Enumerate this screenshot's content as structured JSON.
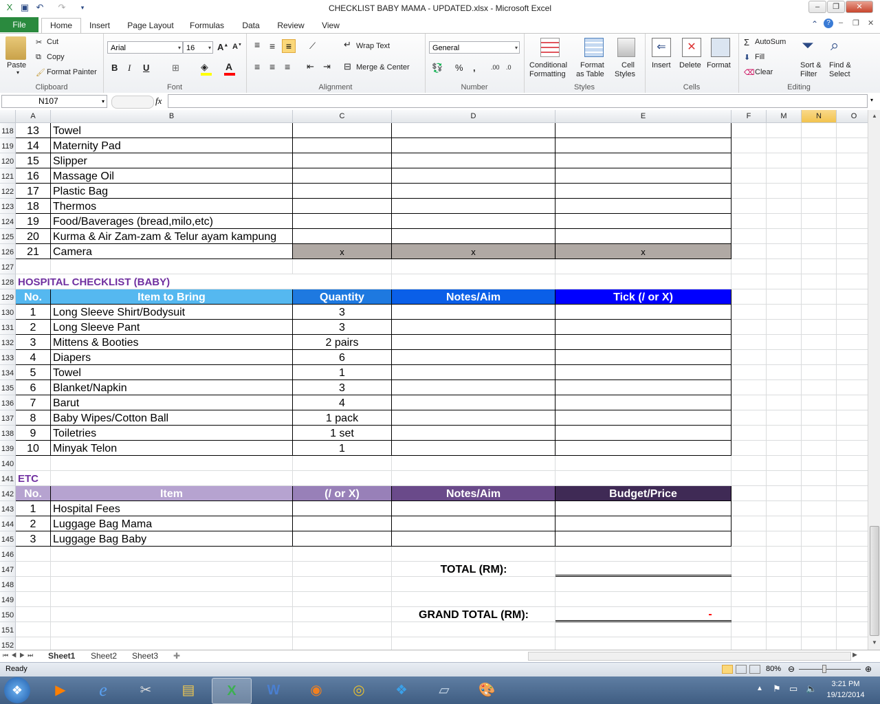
{
  "window": {
    "title": "CHECKLIST BABY MAMA - UPDATED.xlsx  -  Microsoft Excel",
    "qat_ghost_text": "..."
  },
  "tabs": [
    "File",
    "Home",
    "Insert",
    "Page Layout",
    "Formulas",
    "Data",
    "Review",
    "View"
  ],
  "ribbon": {
    "clipboard": {
      "paste": "Paste",
      "cut": "Cut",
      "copy": "Copy",
      "format_painter": "Format Painter",
      "label": "Clipboard"
    },
    "font": {
      "name": "Arial",
      "size": "16",
      "bold": "B",
      "italic": "I",
      "underline": "U",
      "label": "Font"
    },
    "alignment": {
      "wrap": "Wrap Text",
      "merge": "Merge & Center",
      "label": "Alignment"
    },
    "number": {
      "format": "General",
      "percent": "%",
      "comma": ",",
      "label": "Number"
    },
    "styles": {
      "conditional": "Conditional",
      "conditional2": "Formatting",
      "format_table": "Format",
      "format_table2": "as Table",
      "cell_styles": "Cell",
      "cell_styles2": "Styles",
      "label": "Styles"
    },
    "cells": {
      "insert": "Insert",
      "delete": "Delete",
      "format": "Format",
      "label": "Cells"
    },
    "editing": {
      "autosum": "AutoSum",
      "fill": "Fill",
      "clear": "Clear",
      "sort": "Sort &",
      "sort2": "Filter",
      "find": "Find &",
      "find2": "Select",
      "label": "Editing"
    }
  },
  "formula_bar": {
    "name_box": "N107",
    "fx": "fx",
    "value": ""
  },
  "columns": [
    "A",
    "B",
    "C",
    "D",
    "E",
    "F",
    "M",
    "N",
    "O"
  ],
  "rows": {
    "mama": [
      {
        "row": "118",
        "no": "13",
        "item": "Towel"
      },
      {
        "row": "119",
        "no": "14",
        "item": "Maternity Pad"
      },
      {
        "row": "120",
        "no": "15",
        "item": "Slipper"
      },
      {
        "row": "121",
        "no": "16",
        "item": "Massage Oil"
      },
      {
        "row": "122",
        "no": "17",
        "item": "Plastic Bag"
      },
      {
        "row": "123",
        "no": "18",
        "item": "Thermos"
      },
      {
        "row": "124",
        "no": "19",
        "item": "Food/Baverages (bread,milo,etc)"
      },
      {
        "row": "125",
        "no": "20",
        "item": "Kurma & Air Zam-zam & Telur ayam kampung"
      },
      {
        "row": "126",
        "no": "21",
        "item": "Camera",
        "c": "x",
        "d": "x",
        "e": "x"
      }
    ],
    "blank_127": "127",
    "baby_title_row": "128",
    "baby_title": "HOSPITAL CHECKLIST (BABY)",
    "baby_header_row": "129",
    "baby_header": {
      "no": "No.",
      "item": "Item to Bring",
      "qty": "Quantity",
      "notes": "Notes/Aim",
      "tick": "Tick (/ or X)"
    },
    "baby": [
      {
        "row": "130",
        "no": "1",
        "item": "Long Sleeve Shirt/Bodysuit",
        "qty": "3"
      },
      {
        "row": "131",
        "no": "2",
        "item": "Long Sleeve Pant",
        "qty": "3"
      },
      {
        "row": "132",
        "no": "3",
        "item": "Mittens & Booties",
        "qty": "2 pairs"
      },
      {
        "row": "133",
        "no": "4",
        "item": "Diapers",
        "qty": "6"
      },
      {
        "row": "134",
        "no": "5",
        "item": "Towel",
        "qty": "1"
      },
      {
        "row": "135",
        "no": "6",
        "item": "Blanket/Napkin",
        "qty": "3"
      },
      {
        "row": "136",
        "no": "7",
        "item": "Barut",
        "qty": "4"
      },
      {
        "row": "137",
        "no": "8",
        "item": "Baby Wipes/Cotton Ball",
        "qty": "1 pack"
      },
      {
        "row": "138",
        "no": "9",
        "item": "Toiletries",
        "qty": "1 set"
      },
      {
        "row": "139",
        "no": "10",
        "item": "Minyak Telon",
        "qty": "1"
      }
    ],
    "blank_140": "140",
    "etc_title_row": "141",
    "etc_title": "ETC",
    "etc_header_row": "142",
    "etc_header": {
      "no": "No.",
      "item": "Item",
      "tick": "(/ or X)",
      "notes": "Notes/Aim",
      "budget": "Budget/Price"
    },
    "etc": [
      {
        "row": "143",
        "no": "1",
        "item": "Hospital Fees"
      },
      {
        "row": "144",
        "no": "2",
        "item": "Luggage Bag Mama"
      },
      {
        "row": "145",
        "no": "3",
        "item": "Luggage Bag Baby"
      }
    ],
    "r146": "146",
    "r147": "147",
    "r148": "148",
    "r149": "149",
    "r150": "150",
    "r151": "151",
    "r152": "152",
    "total_label": "TOTAL (RM):",
    "grand_total_label": "GRAND TOTAL (RM):",
    "grand_total_value": "-"
  },
  "sheets": [
    "Sheet1",
    "Sheet2",
    "Sheet3"
  ],
  "status": {
    "ready": "Ready",
    "zoom": "80%"
  },
  "clock": {
    "time": "3:21 PM",
    "date": "19/12/2014"
  },
  "colors": {
    "file_tab": "#2a8a3e",
    "baby_hdr_1": "#55b8f0",
    "baby_hdr_2": "#1e79e0",
    "baby_hdr_3": "#0a5fe8",
    "baby_hdr_4": "#0000ff",
    "etc_hdr_1": "#b6a3d0",
    "etc_hdr_2": "#9880b8",
    "etc_hdr_3": "#6a4a8a",
    "etc_hdr_4": "#3f2a55",
    "section_title": "#7030a0",
    "camera_fill": "#b0a9a4"
  }
}
